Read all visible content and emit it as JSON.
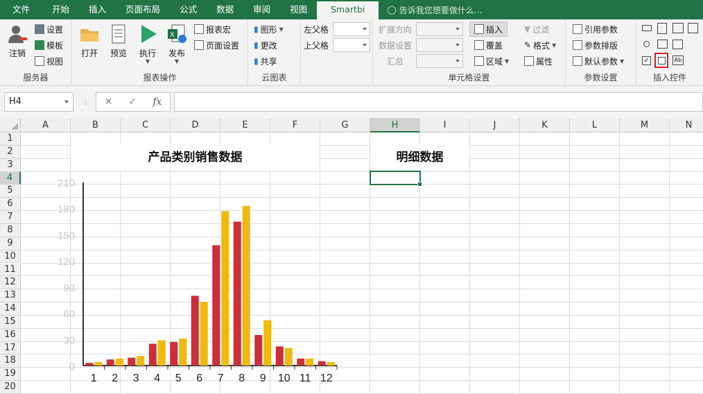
{
  "tabs": [
    "文件",
    "开始",
    "插入",
    "页面布局",
    "公式",
    "数据",
    "审阅",
    "视图",
    "Smartbi"
  ],
  "active_tab": "Smartbi",
  "tell_me": "告诉我您想要做什么...",
  "ribbon": {
    "server": {
      "label": "服务器",
      "logout": "注销",
      "settings": "设置",
      "template": "模板",
      "view": "视图"
    },
    "report_ops": {
      "label": "报表操作",
      "open": "打开",
      "preview": "预览",
      "execute": "执行",
      "publish": "发布",
      "report_macro": "报表宏",
      "page_setup": "页面设置"
    },
    "cloud_chart": {
      "label": "云图表",
      "graph": "图形",
      "change": "更改",
      "share": "共享"
    },
    "parent_cell": {
      "left": "左父格",
      "up": "上父格"
    },
    "cell_settings": {
      "label": "单元格设置",
      "expand_dir": "扩展方向",
      "data_settings": "数据设置",
      "summary": "汇总",
      "insert": "插入",
      "cover": "覆盖",
      "region": "区域",
      "filter": "过滤",
      "format": "格式",
      "property": "属性"
    },
    "param_settings": {
      "label": "参数设置",
      "ref_param": "引用参数",
      "param_layout": "参数排版",
      "default_param": "默认参数"
    },
    "insert_controls": {
      "label": "插入控件"
    }
  },
  "formula_bar": {
    "name_box": "H4",
    "fx": "fx",
    "formula": ""
  },
  "sheet": {
    "columns": [
      "A",
      "B",
      "C",
      "D",
      "E",
      "F",
      "G",
      "H",
      "I",
      "J",
      "K",
      "L",
      "M",
      "N"
    ],
    "rows": [
      "1",
      "2",
      "3",
      "4",
      "5",
      "6",
      "7",
      "8",
      "9",
      "10",
      "11",
      "12",
      "13",
      "14",
      "15",
      "16",
      "17",
      "18",
      "19",
      "20"
    ],
    "selected_cell": "H4",
    "title_left": "产品类别销售数据",
    "title_right": "明细数据"
  },
  "chart_data": {
    "type": "bar",
    "categories": [
      "1",
      "2",
      "3",
      "4",
      "5",
      "6",
      "7",
      "8",
      "9",
      "10",
      "11",
      "12"
    ],
    "series": [
      {
        "values": [
          3,
          7,
          9,
          25,
          27,
          80,
          138,
          165,
          35,
          22,
          8,
          5
        ],
        "color": "#cc2f3a"
      },
      {
        "values": [
          4,
          8,
          11,
          29,
          31,
          73,
          177,
          183,
          52,
          20,
          8,
          4
        ],
        "color": "#f0b90b"
      }
    ],
    "yticks": [
      0,
      30,
      60,
      90,
      120,
      150,
      180,
      210
    ],
    "ylim": [
      0,
      210
    ],
    "colors": {
      "red": "#cc2f3a",
      "yellow": "#f0b90b",
      "axis": "#333333",
      "tick": "#c8c8c8"
    }
  },
  "colors": {
    "excel_green": "#217346",
    "ribbon_bg": "#f3f3f3",
    "highlight_red": "#e0191f"
  }
}
